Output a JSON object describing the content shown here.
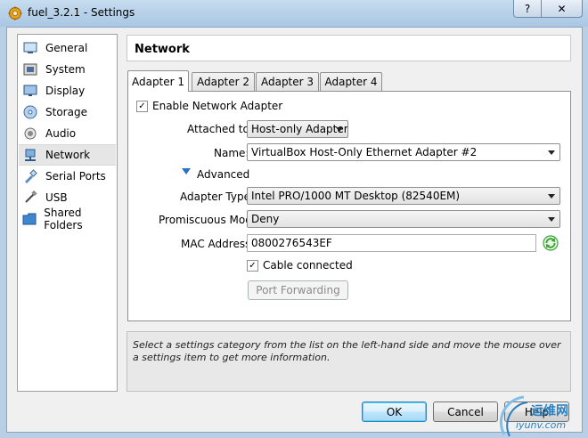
{
  "window": {
    "title": "fuel_3.2.1 - Settings",
    "help_label": "?",
    "close_label": "✕"
  },
  "sidebar": {
    "items": [
      {
        "label": "General",
        "icon": "general-icon"
      },
      {
        "label": "System",
        "icon": "system-icon"
      },
      {
        "label": "Display",
        "icon": "display-icon"
      },
      {
        "label": "Storage",
        "icon": "storage-icon"
      },
      {
        "label": "Audio",
        "icon": "audio-icon"
      },
      {
        "label": "Network",
        "icon": "network-icon",
        "selected": true
      },
      {
        "label": "Serial Ports",
        "icon": "serial-ports-icon"
      },
      {
        "label": "USB",
        "icon": "usb-icon"
      },
      {
        "label": "Shared Folders",
        "icon": "shared-folders-icon"
      }
    ]
  },
  "header": {
    "title": "Network"
  },
  "tabs": [
    {
      "label": "Adapter 1",
      "active": true
    },
    {
      "label": "Adapter 2"
    },
    {
      "label": "Adapter 3"
    },
    {
      "label": "Adapter 4"
    }
  ],
  "adapter": {
    "enable_label": "Enable Network Adapter",
    "enable_checked": "✓",
    "attached_label": "Attached to:",
    "attached_value": "Host-only Adapter",
    "name_label": "Name:",
    "name_value": "VirtualBox Host-Only Ethernet Adapter #2",
    "advanced_label": "Advanced",
    "adapter_type_label": "Adapter Type:",
    "adapter_type_value": "Intel PRO/1000 MT Desktop (82540EM)",
    "promiscuous_label": "Promiscuous Mode:",
    "promiscuous_value": "Deny",
    "mac_label": "MAC Address:",
    "mac_value": "0800276543EF",
    "cable_label": "Cable connected",
    "cable_checked": "✓",
    "port_forwarding_label": "Port Forwarding"
  },
  "info": {
    "text": "Select a settings category from the list on the left-hand side and move the mouse over a settings item to get more information."
  },
  "buttons": {
    "ok": "OK",
    "cancel": "Cancel",
    "help": "Help"
  },
  "watermark": {
    "line1": "运维网",
    "line2": "iyunv.com"
  },
  "colors": {
    "accent": "#3c7fb1",
    "refresh_icon": "#3aa335"
  }
}
